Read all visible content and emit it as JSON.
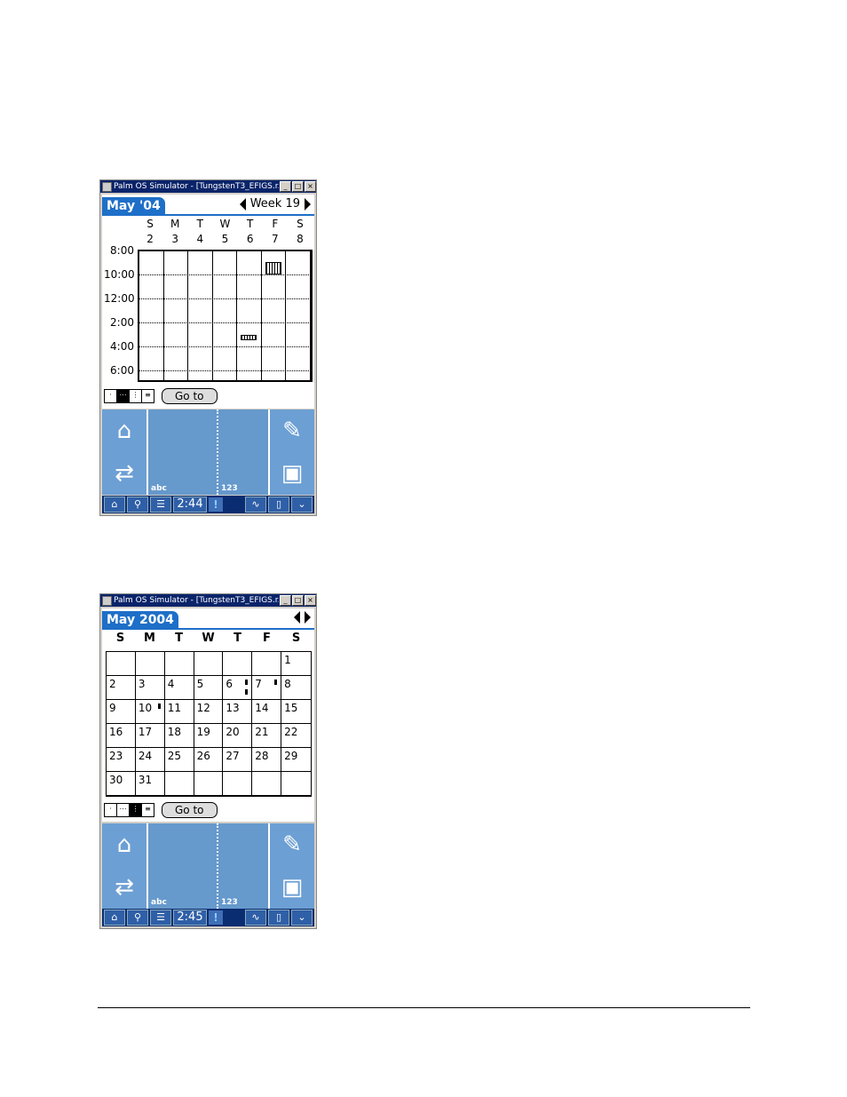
{
  "window_title": "Palm OS Simulator - [TungstenT3_EFIGS.r...",
  "window_controls": [
    "minimize",
    "maximize",
    "close"
  ],
  "week_view": {
    "month_tab": "May '04",
    "week_label": "Week 19",
    "day_letters": [
      "S",
      "M",
      "T",
      "W",
      "T",
      "F",
      "S"
    ],
    "day_numbers": [
      "2",
      "3",
      "4",
      "5",
      "6",
      "7",
      "8"
    ],
    "time_labels": [
      "8:00",
      "10:00",
      "12:00",
      "2:00",
      "4:00",
      "6:00"
    ],
    "events": [
      {
        "day": "7",
        "start": "9:00",
        "end": "10:00"
      },
      {
        "day": "6",
        "start": "3:00",
        "end": "3:30"
      }
    ],
    "view_buttons": [
      "day",
      "week",
      "month",
      "agenda"
    ],
    "selected_view": "week",
    "goto_label": "Go to",
    "clock": "2:44"
  },
  "month_view": {
    "month_tab": "May 2004",
    "day_letters": [
      "S",
      "M",
      "T",
      "W",
      "T",
      "F",
      "S"
    ],
    "cells": [
      "",
      "",
      "",
      "",
      "",
      "",
      "1",
      "2",
      "3",
      "4",
      "5",
      "6",
      "7",
      "8",
      "9",
      "10",
      "11",
      "12",
      "13",
      "14",
      "15",
      "16",
      "17",
      "18",
      "19",
      "20",
      "21",
      "22",
      "23",
      "24",
      "25",
      "26",
      "27",
      "28",
      "29",
      "30",
      "31",
      "",
      "",
      "",
      "",
      ""
    ],
    "days_with_events": [
      "6",
      "7",
      "10"
    ],
    "view_buttons": [
      "day",
      "week",
      "month",
      "agenda"
    ],
    "selected_view": "month",
    "goto_label": "Go to",
    "clock": "2:45"
  },
  "graffiti": {
    "abc_label": "abc",
    "num_label": "123"
  },
  "status_icons": [
    "home-icon",
    "find-icon",
    "menu-icon",
    "alert-icon",
    "graffiti-icon",
    "rotate-icon",
    "input-area-icon"
  ],
  "colors": {
    "accent": "#1e6fc8",
    "graffiti_bg": "#6699cc",
    "status_bg": "#0a2c70"
  }
}
